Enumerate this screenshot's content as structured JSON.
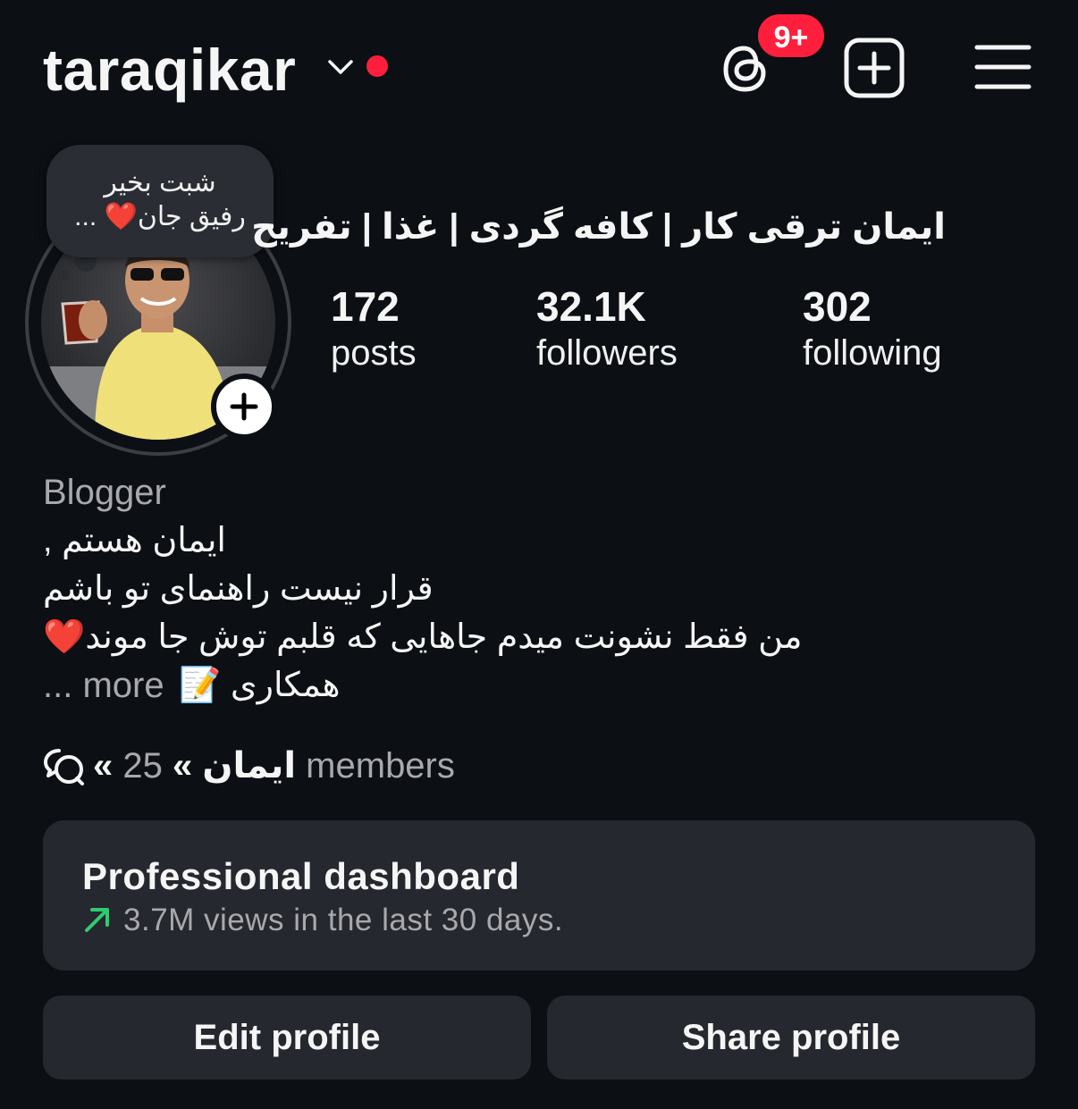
{
  "header": {
    "username": "taraqikar",
    "threads_badge": "9+",
    "accent": "#ff1f3d"
  },
  "note": {
    "line1": "شبت بخیر",
    "line2": "رفیق جان❤️ ..."
  },
  "profile": {
    "full_name": "ایمان ترقی کار | کافه گردی  | غذا | تفریح",
    "stats": [
      {
        "value": "172",
        "label": "posts"
      },
      {
        "value": "32.1K",
        "label": "followers"
      },
      {
        "value": "302",
        "label": "following"
      }
    ]
  },
  "bio": {
    "category": "Blogger",
    "lines": [
      "ایمان هستم ,",
      "قرار نیست راهنمای تو باشم",
      "من فقط نشونت میدم جاهایی که قلبم توش جا موند❤️",
      "همکاری 📝"
    ],
    "more": "... more"
  },
  "channel": {
    "name": "« ایمان »",
    "members": "25 members"
  },
  "dashboard": {
    "title": "Professional dashboard",
    "subtitle": "3.7M views in the last 30 days.",
    "trend_color": "#2ecc71"
  },
  "actions": {
    "edit": "Edit profile",
    "share": "Share profile"
  }
}
